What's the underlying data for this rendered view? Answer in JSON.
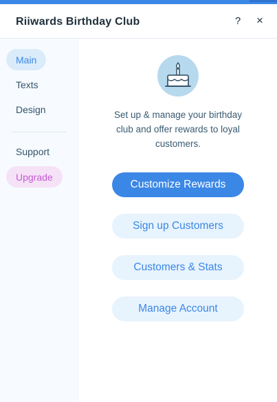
{
  "header": {
    "title": "Riiwards Birthday Club",
    "help_label": "?",
    "close_label": "×"
  },
  "sidebar": {
    "items": [
      {
        "label": "Main",
        "state": "active"
      },
      {
        "label": "Texts",
        "state": "default"
      },
      {
        "label": "Design",
        "state": "default"
      },
      {
        "label": "Support",
        "state": "default"
      },
      {
        "label": "Upgrade",
        "state": "upgrade"
      }
    ]
  },
  "main": {
    "hero_icon": "birthday-cake-icon",
    "description": "Set up & manage your birthday club and offer rewards to loyal customers.",
    "buttons": {
      "customize_rewards": "Customize Rewards",
      "sign_up_customers": "Sign up Customers",
      "customers_stats": "Customers & Stats",
      "manage_account": "Manage Account"
    }
  },
  "colors": {
    "accent": "#3b87e6",
    "upgrade": "#c35ad4",
    "sidebar_bg": "#f7fbff",
    "secondary_button_bg": "#e7f3fd"
  }
}
